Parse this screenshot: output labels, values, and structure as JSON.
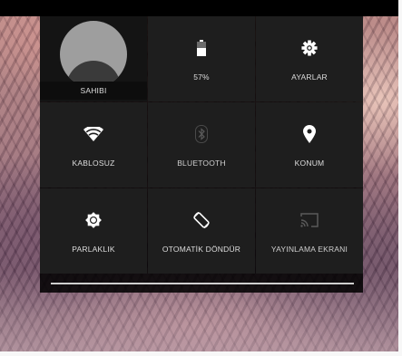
{
  "quick_settings": {
    "owner_label": "SAHIBI",
    "battery_label": "57%",
    "battery_level": 0.57,
    "settings_label": "AYARLAR",
    "wifi_label": "KABLOSUZ",
    "bluetooth_label": "BLUETOOTH",
    "location_label": "KONUM",
    "brightness_label": "PARLAKLIK",
    "autorotate_label": "OTOMATİK DÖNDÜR",
    "cast_label": "YAYINLAMA EKRANI",
    "brightness_level": 1.0
  },
  "icons": {
    "owner": "avatar",
    "battery": "battery-icon",
    "settings": "gear-icon",
    "wifi": "wifi-icon",
    "bluetooth": "bluetooth-icon",
    "location": "location-pin-icon",
    "brightness": "brightness-icon",
    "autorotate": "rotate-icon",
    "cast": "cast-icon"
  },
  "colors": {
    "panel": "#1e1e1e",
    "active_icon": "#ffffff",
    "inactive_icon": "#5a5a5a"
  }
}
